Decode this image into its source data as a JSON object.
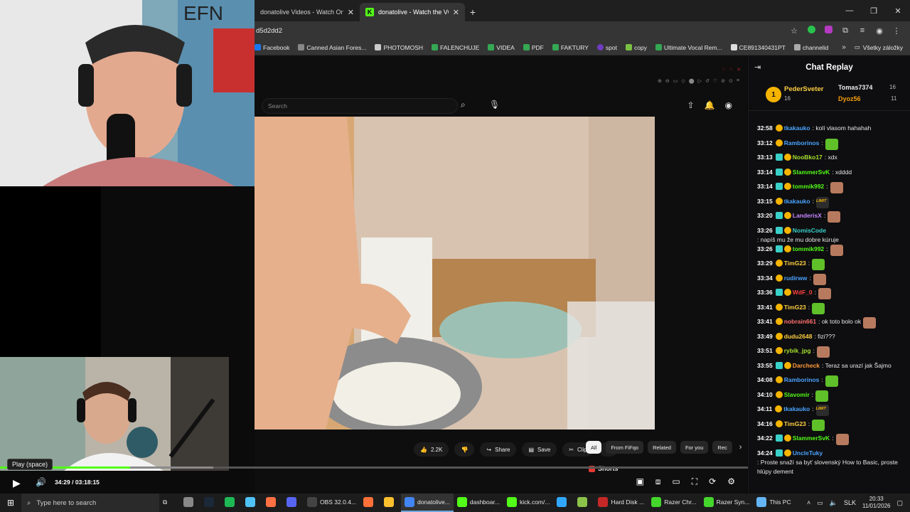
{
  "browser": {
    "tabs": [
      {
        "label": "donatolive Videos - Watch On",
        "active": false
      },
      {
        "label": "donatolive - Watch the VOD on",
        "active": true
      }
    ],
    "url": "d5d2dd2",
    "bookmarks": [
      {
        "label": "Facebook",
        "color": "#1877f2"
      },
      {
        "label": "Canned Asian Fores...",
        "color": "#888888"
      },
      {
        "label": "PHOTOMOSH",
        "color": "#cccccc"
      },
      {
        "label": "FALENCHUJE",
        "color": "#34a853"
      },
      {
        "label": "VIDEA",
        "color": "#34a853"
      },
      {
        "label": "PDF",
        "color": "#34a853"
      },
      {
        "label": "FAKTURY",
        "color": "#34a853"
      },
      {
        "label": "spot",
        "color": "#6f3cc2"
      },
      {
        "label": "copy",
        "color": "#7ac142"
      },
      {
        "label": "Ultimate Vocal Rem...",
        "color": "#34a853"
      },
      {
        "label": "CE891340431PT",
        "color": "#dddddd"
      },
      {
        "label": "channelid",
        "color": "#aaaaaa"
      }
    ],
    "all_bookmarks": "Všetky záložky"
  },
  "youtube": {
    "search_placeholder": "Search",
    "actions": [
      {
        "label": "2.2K",
        "icon": "thumbs-up-icon"
      },
      {
        "label": "",
        "icon": "thumbs-down-icon"
      },
      {
        "label": "Share",
        "icon": "share-icon"
      },
      {
        "label": "Save",
        "icon": "save-icon"
      },
      {
        "label": "Clip",
        "icon": "scissors-icon"
      },
      {
        "label": "•••",
        "icon": "more-icon"
      }
    ],
    "chips": [
      {
        "label": "All",
        "active": true
      },
      {
        "label": "From FiFqo",
        "active": false
      },
      {
        "label": "Related",
        "active": false
      },
      {
        "label": "For you",
        "active": false
      },
      {
        "label": "Rec",
        "active": false
      }
    ],
    "shorts_label": "Shorts"
  },
  "player": {
    "tooltip": "Play (space)",
    "current_time": "34:29",
    "separator": "/",
    "duration": "03:18:15",
    "progress_fraction": 0.174
  },
  "chat": {
    "title": "Chat Replay",
    "leaderboard": {
      "rank": "1",
      "first": {
        "name": "PederSveter",
        "count": "16"
      },
      "second": {
        "name": "Tomas7374",
        "count": "16"
      },
      "third": {
        "name": "Dyoz56",
        "count": "11"
      }
    },
    "messages": [
      {
        "time": "32:58",
        "sub": false,
        "user": "tkakauko",
        "color": "#4aa3ff",
        "text": ": kolí vlasom hahahah",
        "emote": ""
      },
      {
        "time": "33:12",
        "sub": false,
        "user": "Ramborinos",
        "color": "#4aa3ff",
        "text": ":",
        "emote": "em-green"
      },
      {
        "time": "33:13",
        "sub": true,
        "user": "NooBko17",
        "color": "#a6e22e",
        "text": ": xdx",
        "emote": ""
      },
      {
        "time": "33:14",
        "sub": true,
        "user": "SlammerSvK",
        "color": "#53fc18",
        "text": ": xdddd",
        "emote": ""
      },
      {
        "time": "33:14",
        "sub": true,
        "user": "tommik992",
        "color": "#53fc18",
        "text": ":",
        "emote": "em-face"
      },
      {
        "time": "33:15",
        "sub": false,
        "user": "tkakauko",
        "color": "#4aa3ff",
        "text": ":",
        "emote": "em-limit"
      },
      {
        "time": "33:20",
        "sub": true,
        "user": "LanderisX",
        "color": "#c586ff",
        "text": ":",
        "emote": "em-face"
      },
      {
        "time": "33:26",
        "sub": true,
        "user": "NomisCode",
        "color": "#39d0c9",
        "text": ": napíš mu že mu dobre kúruje",
        "emote": ""
      },
      {
        "time": "33:26",
        "sub": true,
        "user": "tommik992",
        "color": "#53fc18",
        "text": ":",
        "emote": "em-face"
      },
      {
        "time": "33:29",
        "sub": false,
        "user": "TimG23",
        "color": "#ffcf40",
        "text": ":",
        "emote": "em-green"
      },
      {
        "time": "33:34",
        "sub": false,
        "user": "rudirww",
        "color": "#4aa3ff",
        "text": ":",
        "emote": "em-face"
      },
      {
        "time": "33:36",
        "sub": true,
        "user": "WdF_0",
        "color": "#ff4040",
        "text": ":",
        "emote": "em-face"
      },
      {
        "time": "33:41",
        "sub": false,
        "user": "TimG23",
        "color": "#ffcf40",
        "text": ":",
        "emote": "em-green"
      },
      {
        "time": "33:41",
        "sub": false,
        "user": "nobrain661",
        "color": "#ff6f6f",
        "text": ": ok toto bolo ok",
        "emote": "em-face"
      },
      {
        "time": "33:49",
        "sub": false,
        "user": "dudu2648",
        "color": "#ffcf40",
        "text": ": fizi???",
        "emote": ""
      },
      {
        "time": "33:51",
        "sub": false,
        "user": "rybik_jpg",
        "color": "#a6e22e",
        "text": ":",
        "emote": "em-face"
      },
      {
        "time": "33:55",
        "sub": true,
        "user": "Darcheck",
        "color": "#ff9a3c",
        "text": ": Teraz sa urazí jak Šajmo",
        "emote": ""
      },
      {
        "time": "34:08",
        "sub": false,
        "user": "Ramborinos",
        "color": "#4aa3ff",
        "text": ":",
        "emote": "em-green"
      },
      {
        "time": "34:10",
        "sub": false,
        "user": "Slavomir",
        "color": "#53fc18",
        "text": ":",
        "emote": "em-green"
      },
      {
        "time": "34:11",
        "sub": false,
        "user": "tkakauko",
        "color": "#4aa3ff",
        "text": ":",
        "emote": "em-limit"
      },
      {
        "time": "34:16",
        "sub": false,
        "user": "TimG23",
        "color": "#ffcf40",
        "text": ":",
        "emote": "em-green"
      },
      {
        "time": "34:22",
        "sub": true,
        "user": "SlammerSvK",
        "color": "#53fc18",
        "text": ":",
        "emote": "em-face"
      },
      {
        "time": "34:24",
        "sub": true,
        "user": "UncleTuky",
        "color": "#4aa3ff",
        "text": ": Proste snaží sa byť slovenský How to Basic, proste hlúpy dement",
        "emote": ""
      }
    ]
  },
  "taskbar": {
    "search_placeholder": "Type here to search",
    "apps": [
      {
        "label": "",
        "color": "#888888",
        "active": false
      },
      {
        "label": "",
        "color": "#1b2838",
        "active": false
      },
      {
        "label": "",
        "color": "#1db954",
        "active": false
      },
      {
        "label": "",
        "color": "#4fc3f7",
        "active": false
      },
      {
        "label": "",
        "color": "#ff7043",
        "active": false
      },
      {
        "label": "",
        "color": "#5865f2",
        "active": false
      },
      {
        "label": "OBS 32.0.4...",
        "color": "#444444",
        "active": false
      },
      {
        "label": "",
        "color": "#ff7139",
        "active": false
      },
      {
        "label": "",
        "color": "#fbc02d",
        "active": false
      },
      {
        "label": "donatolive...",
        "color": "#4285f4",
        "active": true
      },
      {
        "label": "dashboar...",
        "color": "#53fc18",
        "active": false
      },
      {
        "label": "kick.com/...",
        "color": "#53fc18",
        "active": false
      },
      {
        "label": "",
        "color": "#31a8ff",
        "active": false
      },
      {
        "label": "",
        "color": "#8bc34a",
        "active": false
      },
      {
        "label": "Hard Disk ...",
        "color": "#c62828",
        "active": false
      },
      {
        "label": "Razer Chr...",
        "color": "#44d62c",
        "active": false
      },
      {
        "label": "Razer Syn...",
        "color": "#44d62c",
        "active": false
      },
      {
        "label": "This PC",
        "color": "#64b5f6",
        "active": false
      }
    ],
    "language": "SLK",
    "time": "20:33",
    "date": "11/01/2026"
  }
}
